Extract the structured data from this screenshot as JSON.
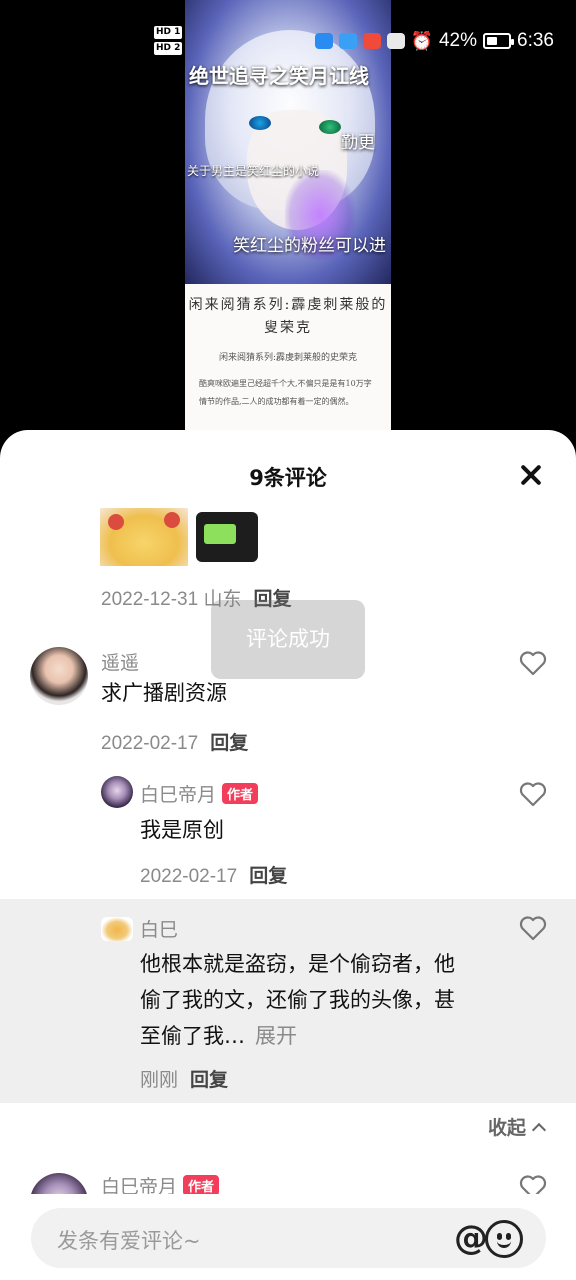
{
  "status_bar": {
    "hd1": "HD 1",
    "hd2": "HD 2",
    "battery_percent": "42%",
    "time": "6:36"
  },
  "cover": {
    "line1": "绝世追寻之笑月讧线",
    "line2": "勤更",
    "line3": "关于男主是笑红尘的小说",
    "line4": "笑红尘的粉丝可以进"
  },
  "paper": {
    "heading": "闲来阅猜系列:霹虔刺莱般的叟荣克",
    "subheading": "闲来阅猜系列:霹虔刺莱般的史荣克",
    "body": "酷爽咪欧遍里己经超千个大,不偏只是是有10万字情节的作品,二人的成功都有着一定的偶然。"
  },
  "sheet": {
    "title": "9条评论",
    "close_icon": "close-icon"
  },
  "comments": {
    "c0": {
      "date": "2022-12-31 山东",
      "reply": "回复"
    },
    "c1": {
      "user": "遥遥",
      "text": "求广播剧资源",
      "date": "2022-02-17",
      "reply": "回复"
    },
    "c2": {
      "user": "白巳帝月",
      "tag": "作者",
      "text": "我是原创",
      "date": "2022-02-17",
      "reply": "回复"
    },
    "c3": {
      "user": "白巳",
      "text": "他根本就是盗窃，是个偷窃者，他偷了我的文，还偷了我的头像，甚至偷了我…",
      "expand": "展开",
      "date": "刚刚",
      "reply": "回复"
    },
    "collapse": "收起",
    "c4": {
      "user": "白巳帝月",
      "tag": "作者"
    }
  },
  "toast": "评论成功",
  "input": {
    "placeholder": "发条有爱评论~",
    "at": "@"
  },
  "colors": {
    "tag": "#f23e5b",
    "highlight": "#efefef"
  }
}
